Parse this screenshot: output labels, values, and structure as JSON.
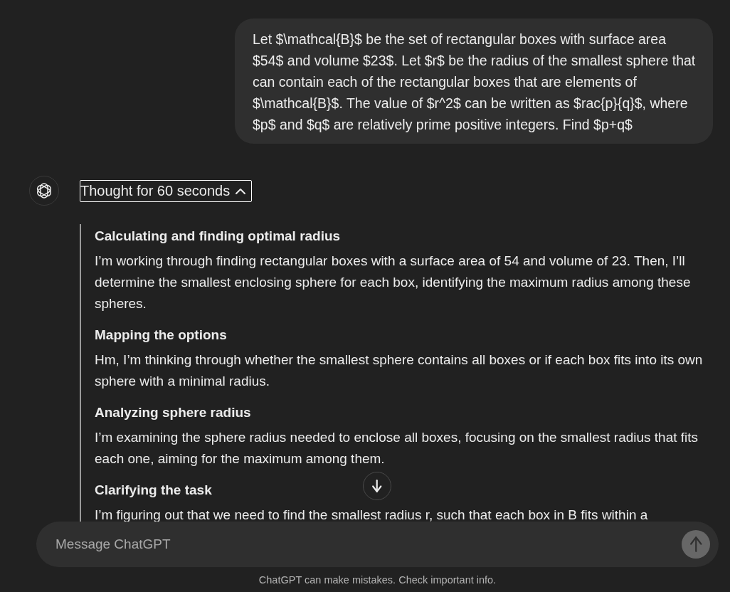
{
  "user_message": {
    "text": "Let $\\mathcal{B}$ be the set of rectangular boxes with surface area $54$ and volume $23$. Let $r$ be the radius of the smallest sphere that can contain each of the rectangular boxes that are elements of $\\mathcal{B}$. The value of $r^2$ can be written as $rac{p}{q}$, where $p$ and $q$ are relatively prime positive integers. Find $p+q$"
  },
  "assistant": {
    "thought_toggle": {
      "label": "Thought for 60 seconds",
      "expanded": true,
      "focused": true
    },
    "thoughts": [
      {
        "heading": "Calculating and finding optimal radius",
        "body": "I’m working through finding rectangular boxes with a surface area of 54 and volume of 23. Then, I’ll determine the smallest enclosing sphere for each box, identifying the maximum radius among these spheres."
      },
      {
        "heading": "Mapping the options",
        "body": "Hm, I’m thinking through whether the smallest sphere contains all boxes or if each box fits into its own sphere with a minimal radius."
      },
      {
        "heading": "Analyzing sphere radius",
        "body": "I’m examining the sphere radius needed to enclose all boxes, focusing on the smallest radius that fits each one, aiming for the maximum among them."
      },
      {
        "heading": "Clarifying the task",
        "body": "I’m figuring out that we need to find the smallest radius r, such that each box in B fits within a"
      }
    ]
  },
  "composer": {
    "placeholder": "Message ChatGPT"
  },
  "send_button": {
    "disabled": true
  },
  "disclaimer": "ChatGPT can make mistakes. Check important info."
}
